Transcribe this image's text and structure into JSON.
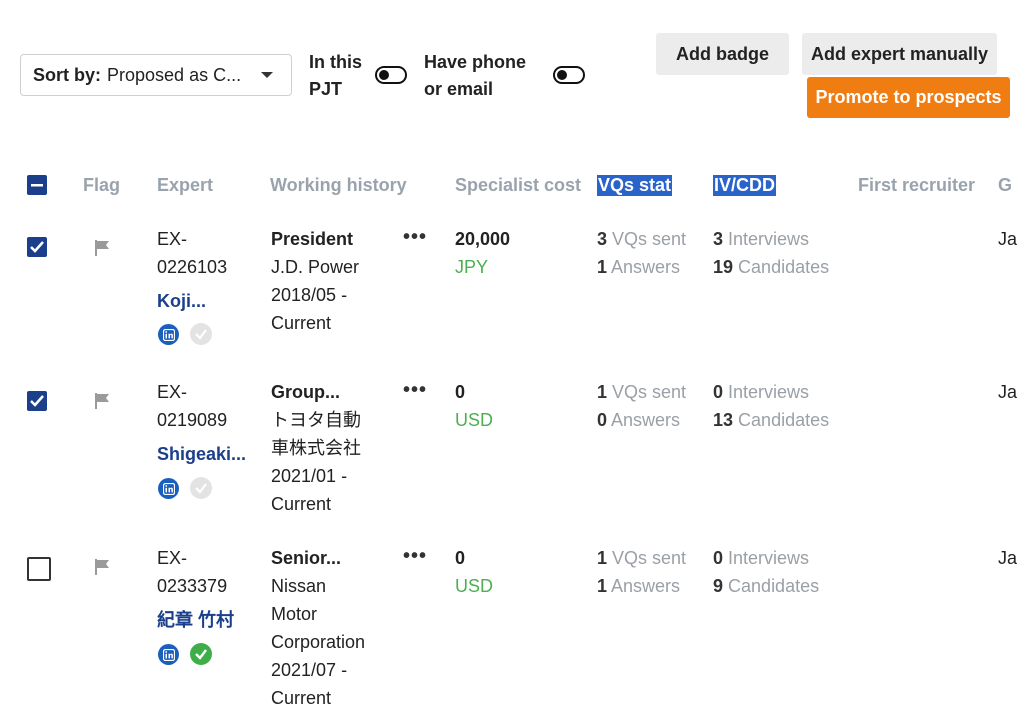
{
  "toolbar": {
    "sort_label": "Sort by:",
    "sort_value": "Proposed as C...",
    "toggle_pjt_line1": "In this",
    "toggle_pjt_line2": "PJT",
    "toggle_contact_line1": "Have phone",
    "toggle_contact_line2": "or email",
    "add_badge": "Add badge",
    "add_expert_manually": "Add expert manually",
    "promote_to_prospects": "Promote to prospects"
  },
  "colors": {
    "accent_orange": "#f07d11",
    "link_blue": "#1b3f8b",
    "highlight_blue": "#2a63c9",
    "currency_green": "#4caf50",
    "verified_green": "#3fae49"
  },
  "table": {
    "headers": {
      "flag": "Flag",
      "expert": "Expert",
      "working_history": "Working history",
      "specialist_cost": "Specialist cost",
      "vqs_stat": "VQs stat",
      "iv_cdd": "IV/CDD",
      "first_recruiter": "First recruiter",
      "next_col_partial": "G"
    },
    "rows": [
      {
        "checked": true,
        "id_line1": "EX-",
        "id_line2": "0226103",
        "name": "Koji...",
        "verified": false,
        "history_title": "President",
        "history_lines": [
          "J.D. Power",
          "2018/05 -",
          "Current"
        ],
        "cost_value": "20,000",
        "cost_currency": "JPY",
        "vqs_sent": "3",
        "vqs_sent_label": "VQs sent",
        "answers": "1",
        "answers_label": "Answers",
        "interviews": "3",
        "interviews_label": "Interviews",
        "candidates": "19",
        "candidates_label": "Candidates",
        "recruiter_partial": "Ja"
      },
      {
        "checked": true,
        "id_line1": "EX-",
        "id_line2": "0219089",
        "name": "Shigeaki...",
        "verified": false,
        "history_title": "Group...",
        "history_lines": [
          "トヨタ自動",
          "車株式会社",
          "2021/01 -",
          "Current"
        ],
        "cost_value": "0",
        "cost_currency": "USD",
        "vqs_sent": "1",
        "vqs_sent_label": "VQs sent",
        "answers": "0",
        "answers_label": "Answers",
        "interviews": "0",
        "interviews_label": "Interviews",
        "candidates": "13",
        "candidates_label": "Candidates",
        "recruiter_partial": "Ja"
      },
      {
        "checked": false,
        "id_line1": "EX-",
        "id_line2": "0233379",
        "name": "紀章 竹村",
        "verified": true,
        "history_title": "Senior...",
        "history_lines": [
          "Nissan",
          "Motor",
          "Corporation",
          "2021/07 -",
          "Current"
        ],
        "cost_value": "0",
        "cost_currency": "USD",
        "vqs_sent": "1",
        "vqs_sent_label": "VQs sent",
        "answers": "1",
        "answers_label": "Answers",
        "interviews": "0",
        "interviews_label": "Interviews",
        "candidates": "9",
        "candidates_label": "Candidates",
        "recruiter_partial": "Ja"
      }
    ]
  }
}
